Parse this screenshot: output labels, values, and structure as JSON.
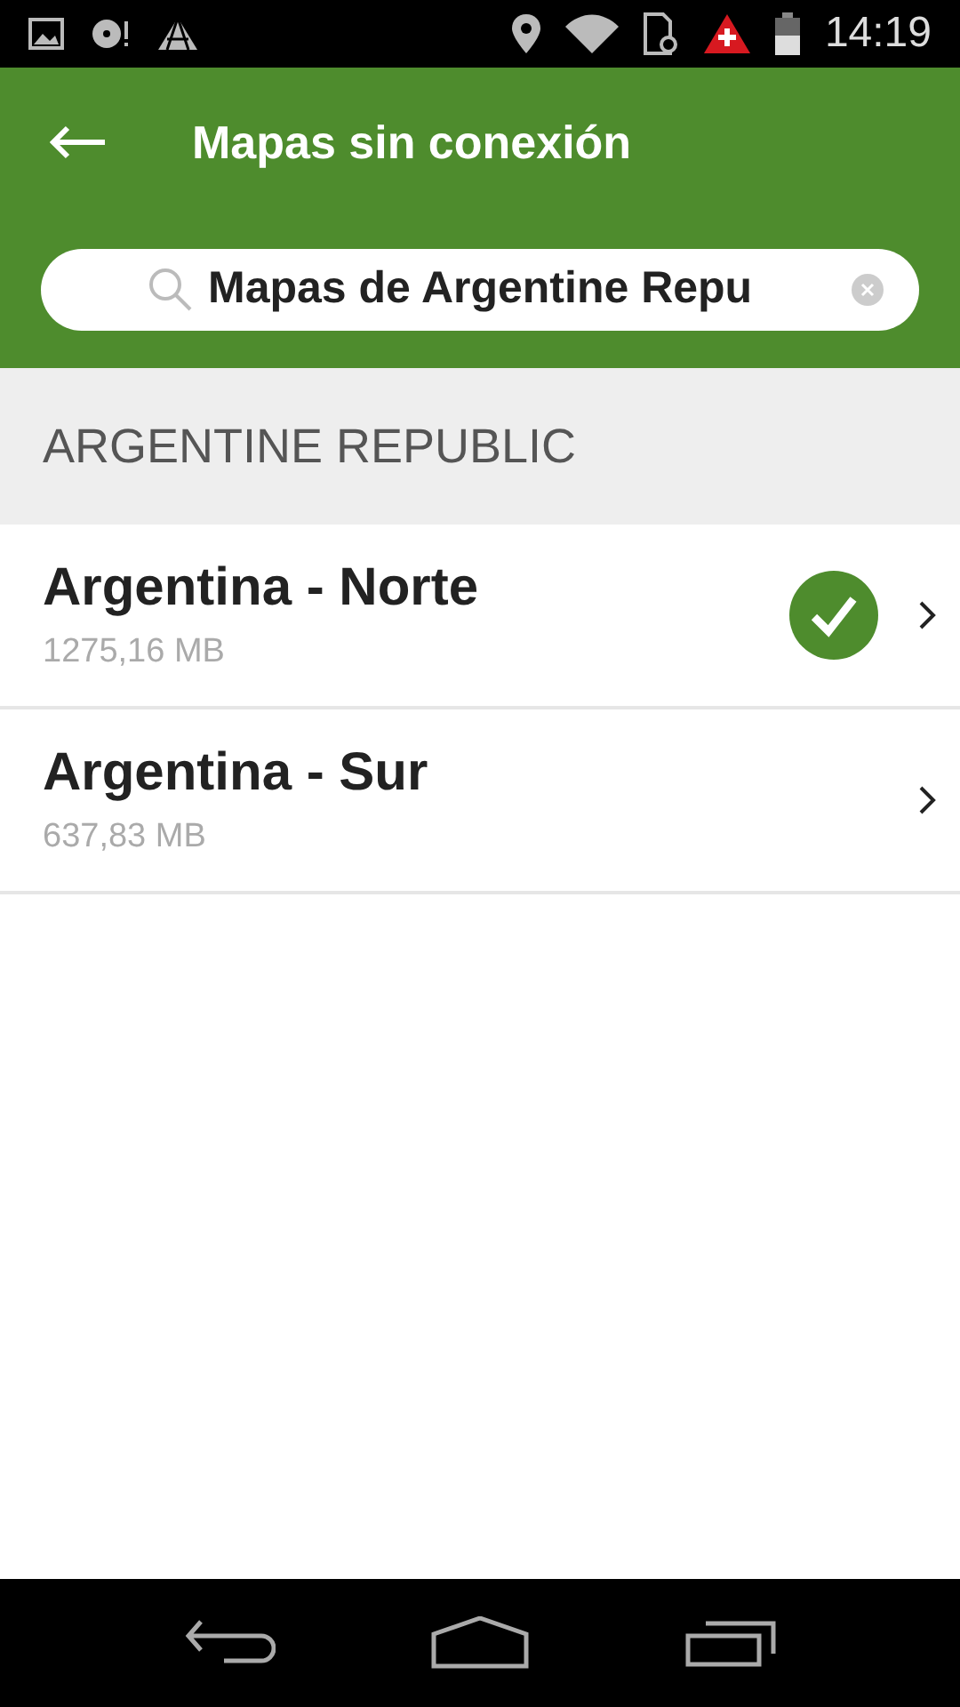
{
  "status_bar": {
    "time": "14:19"
  },
  "header": {
    "title": "Mapas sin conexión"
  },
  "search": {
    "value": "Mapas de Argentine Repu"
  },
  "section": {
    "title": "ARGENTINE REPUBLIC"
  },
  "maps": [
    {
      "name": "Argentina - Norte",
      "size": "1275,16 MB",
      "downloaded": true
    },
    {
      "name": "Argentina - Sur",
      "size": "637,83 MB",
      "downloaded": false
    }
  ]
}
